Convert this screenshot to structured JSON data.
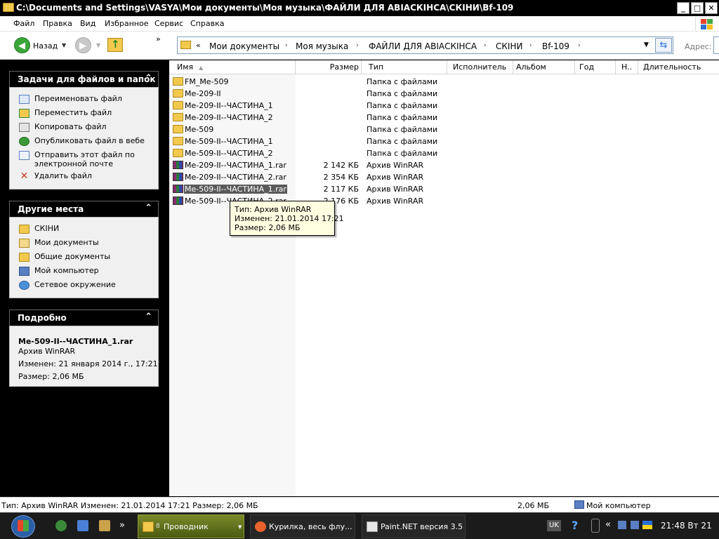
{
  "window": {
    "title": "C:\\Documents and Settings\\VASYA\\Мои документы\\Моя музыка\\ФАЙЛИ ДЛЯ АВІАСКІНСА\\СКІНИ\\Bf-109",
    "minimize": "_",
    "maximize": "□",
    "close": "✕"
  },
  "menu": [
    "Файл",
    "Правка",
    "Вид",
    "Избранное",
    "Сервис",
    "Справка"
  ],
  "toolbar": {
    "back_label": "Назад",
    "overflow": "»"
  },
  "address": {
    "label": "Адрес:",
    "lead": "«",
    "crumbs": [
      "Мои документы",
      "Моя музыка",
      "ФАЙЛИ ДЛЯ АВІАСКІНСА",
      "СКІНИ",
      "Bf-109"
    ],
    "separator": "›"
  },
  "left_panels": {
    "tasks": {
      "title": "Задачи для файлов и папок",
      "items": [
        {
          "label": "Переименовать файл",
          "icon": "rename-icon"
        },
        {
          "label": "Переместить файл",
          "icon": "move-icon"
        },
        {
          "label": "Копировать файл",
          "icon": "copy-icon"
        },
        {
          "label": "Опубликовать файл в вебе",
          "icon": "web-publish-icon"
        },
        {
          "label": "Отправить этот файл по",
          "label2": "электронной почте",
          "icon": "email-icon"
        },
        {
          "label": "Удалить файл",
          "icon": "delete-icon"
        }
      ]
    },
    "places": {
      "title": "Другие места",
      "items": [
        {
          "label": "СКІНИ",
          "icon": "folder-icon"
        },
        {
          "label": "Мои документы",
          "icon": "my-documents-icon"
        },
        {
          "label": "Общие документы",
          "icon": "shared-documents-icon"
        },
        {
          "label": "Мой компьютер",
          "icon": "my-computer-icon"
        },
        {
          "label": "Сетевое окружение",
          "icon": "network-icon"
        }
      ]
    },
    "details": {
      "title": "Подробно",
      "name": "Me-509-II--ЧАСТИНА_1.rar",
      "type": "Архив WinRAR",
      "modified": "Изменен: 21 января 2014 г., 17:21",
      "size": "Размер: 2,06 МБ"
    }
  },
  "columns": [
    "Имя",
    "Размер",
    "Тип",
    "Исполнитель",
    "Альбом",
    "Год",
    "Н..",
    "Длительность"
  ],
  "files": [
    {
      "name": "FM_Me-509",
      "size": "",
      "type": "Папка с файлами",
      "kind": "folder"
    },
    {
      "name": "Me-209-II",
      "size": "",
      "type": "Папка с файлами",
      "kind": "folder"
    },
    {
      "name": "Me-209-II--ЧАСТИНА_1",
      "size": "",
      "type": "Папка с файлами",
      "kind": "folder"
    },
    {
      "name": "Me-209-II--ЧАСТИНА_2",
      "size": "",
      "type": "Папка с файлами",
      "kind": "folder"
    },
    {
      "name": "Me-509",
      "size": "",
      "type": "Папка с файлами",
      "kind": "folder"
    },
    {
      "name": "Me-509-II--ЧАСТИНА_1",
      "size": "",
      "type": "Папка с файлами",
      "kind": "folder"
    },
    {
      "name": "Me-509-II--ЧАСТИНА_2",
      "size": "",
      "type": "Папка с файлами",
      "kind": "folder"
    },
    {
      "name": "Me-209-II--ЧАСТИНА_1.rar",
      "size": "2 142 КБ",
      "type": "Архив WinRAR",
      "kind": "rar"
    },
    {
      "name": "Me-209-II--ЧАСТИНА_2.rar",
      "size": "2 354 КБ",
      "type": "Архив WinRAR",
      "kind": "rar"
    },
    {
      "name": "Me-509-II--ЧАСТИНА_1.rar",
      "size": "2 117 КБ",
      "type": "Архив WinRAR",
      "kind": "rar",
      "selected": true
    },
    {
      "name": "Me-509-II--ЧАСТИНА_2.rar",
      "size": "2 176 КБ",
      "type": "Архив WinRAR",
      "kind": "rar"
    }
  ],
  "tooltip": {
    "line1": "Тип: Архив WinRAR",
    "line2": "Изменен: 21.01.2014 17:21",
    "line3": "Размер: 2,06 МБ"
  },
  "status": {
    "info": "Тип: Архив WinRAR Изменен: 21.01.2014 17:21 Размер: 2,06 МБ",
    "size": "2,06 МБ",
    "location": "Мой компьютер"
  },
  "taskbar": {
    "overflow": "»",
    "buttons": [
      {
        "label": "Проводник",
        "badge": "8"
      },
      {
        "label": "Курилка, весь флу..."
      },
      {
        "label": "Paint.NET версия 3.5"
      }
    ],
    "lang": "UK",
    "help": "?",
    "tray_overflow": "«",
    "clock": "21:48 Вт 21"
  },
  "colors": {
    "folder": "#f2c94c",
    "selection": "#5a5a5a",
    "tooltip_bg": "#ffffe1",
    "back_green": "#3aa63a"
  }
}
